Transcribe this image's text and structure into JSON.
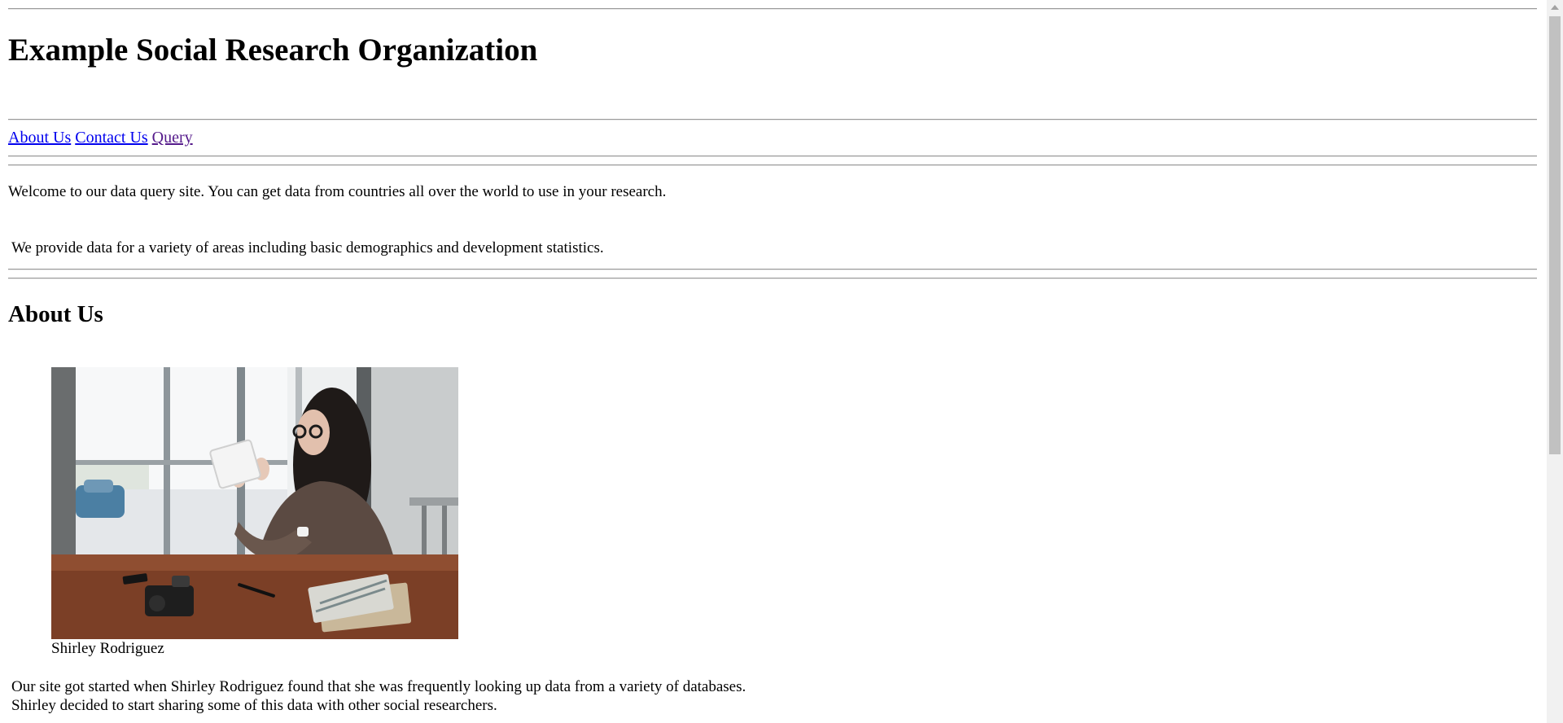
{
  "header": {
    "title": "Example Social Research Organization"
  },
  "nav": {
    "links": [
      {
        "label": "About Us",
        "visited": false
      },
      {
        "label": "Contact Us",
        "visited": false
      },
      {
        "label": "Query",
        "visited": true
      }
    ]
  },
  "intro": {
    "welcome": "Welcome to our data query site. You can get data from countries all over the world to use in your research.",
    "provide": "We provide data for a variety of areas including basic demographics and development statistics."
  },
  "about": {
    "heading": "About Us",
    "photo_caption": "Shirley Rodriguez",
    "story_line1": "Our site got started when Shirley Rodriguez found that she was frequently looking up data from a variety of databases.",
    "story_line2": "Shirley decided to start sharing some of this data with other social researchers."
  },
  "colors": {
    "link": "#0000ee",
    "link_visited": "#551a8b",
    "rule": "#9a9a9a",
    "scrollbar_track": "#f1f1f1",
    "scrollbar_thumb": "#c1c1c1"
  }
}
